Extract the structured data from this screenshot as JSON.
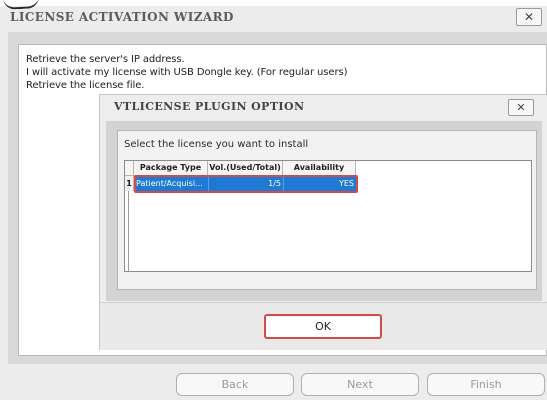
{
  "wizard": {
    "title": "LICENSE ACTIVATION WIZARD",
    "close_glyph": "✕",
    "options": [
      "Retrieve the server's IP address.",
      "I will activate my license with USB Dongle key. (For regular users)",
      "Retrieve the license file."
    ],
    "footer": {
      "back_label": "Back",
      "next_label": "Next",
      "finish_label": "Finish"
    }
  },
  "plugin_dialog": {
    "title": "VTLICENSE PLUGIN OPTION",
    "close_glyph": "✕",
    "prompt": "Select the license you want to install",
    "table": {
      "columns": [
        "Package Type",
        "Vol.(Used/Total)",
        "Availability"
      ],
      "rows": [
        {
          "index": "1",
          "package_type": "Patient/Acquisi...",
          "volume": "1/5",
          "availability": "YES"
        }
      ]
    },
    "ok_label": "OK"
  },
  "colors": {
    "selection_blue": "#1e7ad3",
    "highlight_red": "#d24b4b"
  },
  "icons": {
    "close": "close-icon"
  }
}
